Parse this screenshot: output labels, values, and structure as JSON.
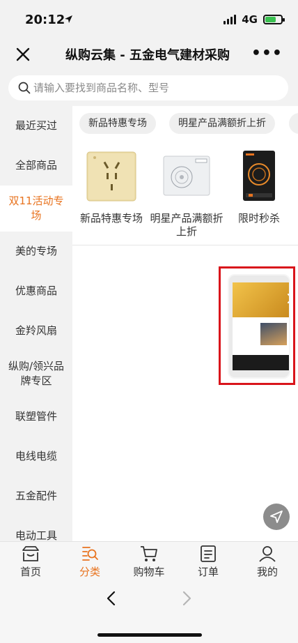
{
  "status_bar": {
    "time": "20:12",
    "network": "4G",
    "battery_level": 0.7
  },
  "nav": {
    "title": "纵购云集 - 五金电气建材采购",
    "more_label": "•••"
  },
  "search": {
    "placeholder": "请输入要找到商品名称、型号"
  },
  "sidebar": {
    "items": [
      {
        "label": "最近买过"
      },
      {
        "label": "全部商品"
      },
      {
        "label": "双11活动专场",
        "active": true
      },
      {
        "label": "美的专场"
      },
      {
        "label": "优惠商品"
      },
      {
        "label": "金羚风扇"
      },
      {
        "label": "纵购/领兴品牌专区"
      },
      {
        "label": "联塑管件"
      },
      {
        "label": "电线电缆"
      },
      {
        "label": "五金配件"
      },
      {
        "label": "电动工具"
      }
    ]
  },
  "chips": [
    {
      "label": "新品特惠专场"
    },
    {
      "label": "明星产品满额折上折"
    },
    {
      "label": ""
    }
  ],
  "products": [
    {
      "name": "新品特惠专场",
      "icon": "wall-socket-icon"
    },
    {
      "name": "明星产品满额折上折",
      "icon": "heater-panel-icon"
    },
    {
      "name": "限时秒杀",
      "icon": "induction-cooker-icon"
    }
  ],
  "tabbar": {
    "items": [
      {
        "label": "首页",
        "icon": "home-icon"
      },
      {
        "label": "分类",
        "icon": "category-search-icon",
        "active": true
      },
      {
        "label": "购物车",
        "icon": "cart-icon"
      },
      {
        "label": "订单",
        "icon": "order-icon"
      },
      {
        "label": "我的",
        "icon": "profile-icon"
      }
    ]
  },
  "colors": {
    "accent": "#e8731f",
    "highlight_border": "#d9141b",
    "sidebar_bg": "#f2f2f2"
  }
}
